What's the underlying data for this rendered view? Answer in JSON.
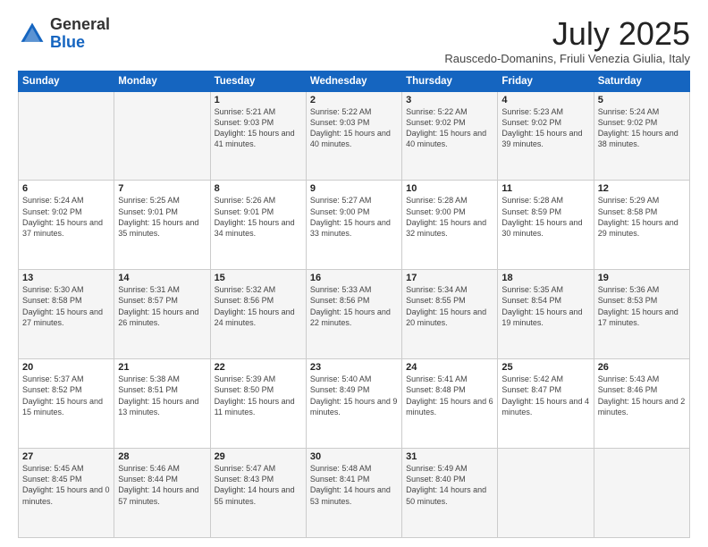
{
  "header": {
    "logo_general": "General",
    "logo_blue": "Blue",
    "title": "July 2025",
    "location": "Rauscedo-Domanins, Friuli Venezia Giulia, Italy"
  },
  "weekdays": [
    "Sunday",
    "Monday",
    "Tuesday",
    "Wednesday",
    "Thursday",
    "Friday",
    "Saturday"
  ],
  "weeks": [
    [
      {
        "day": "",
        "info": ""
      },
      {
        "day": "",
        "info": ""
      },
      {
        "day": "1",
        "info": "Sunrise: 5:21 AM\nSunset: 9:03 PM\nDaylight: 15 hours\nand 41 minutes."
      },
      {
        "day": "2",
        "info": "Sunrise: 5:22 AM\nSunset: 9:03 PM\nDaylight: 15 hours\nand 40 minutes."
      },
      {
        "day": "3",
        "info": "Sunrise: 5:22 AM\nSunset: 9:02 PM\nDaylight: 15 hours\nand 40 minutes."
      },
      {
        "day": "4",
        "info": "Sunrise: 5:23 AM\nSunset: 9:02 PM\nDaylight: 15 hours\nand 39 minutes."
      },
      {
        "day": "5",
        "info": "Sunrise: 5:24 AM\nSunset: 9:02 PM\nDaylight: 15 hours\nand 38 minutes."
      }
    ],
    [
      {
        "day": "6",
        "info": "Sunrise: 5:24 AM\nSunset: 9:02 PM\nDaylight: 15 hours\nand 37 minutes."
      },
      {
        "day": "7",
        "info": "Sunrise: 5:25 AM\nSunset: 9:01 PM\nDaylight: 15 hours\nand 35 minutes."
      },
      {
        "day": "8",
        "info": "Sunrise: 5:26 AM\nSunset: 9:01 PM\nDaylight: 15 hours\nand 34 minutes."
      },
      {
        "day": "9",
        "info": "Sunrise: 5:27 AM\nSunset: 9:00 PM\nDaylight: 15 hours\nand 33 minutes."
      },
      {
        "day": "10",
        "info": "Sunrise: 5:28 AM\nSunset: 9:00 PM\nDaylight: 15 hours\nand 32 minutes."
      },
      {
        "day": "11",
        "info": "Sunrise: 5:28 AM\nSunset: 8:59 PM\nDaylight: 15 hours\nand 30 minutes."
      },
      {
        "day": "12",
        "info": "Sunrise: 5:29 AM\nSunset: 8:58 PM\nDaylight: 15 hours\nand 29 minutes."
      }
    ],
    [
      {
        "day": "13",
        "info": "Sunrise: 5:30 AM\nSunset: 8:58 PM\nDaylight: 15 hours\nand 27 minutes."
      },
      {
        "day": "14",
        "info": "Sunrise: 5:31 AM\nSunset: 8:57 PM\nDaylight: 15 hours\nand 26 minutes."
      },
      {
        "day": "15",
        "info": "Sunrise: 5:32 AM\nSunset: 8:56 PM\nDaylight: 15 hours\nand 24 minutes."
      },
      {
        "day": "16",
        "info": "Sunrise: 5:33 AM\nSunset: 8:56 PM\nDaylight: 15 hours\nand 22 minutes."
      },
      {
        "day": "17",
        "info": "Sunrise: 5:34 AM\nSunset: 8:55 PM\nDaylight: 15 hours\nand 20 minutes."
      },
      {
        "day": "18",
        "info": "Sunrise: 5:35 AM\nSunset: 8:54 PM\nDaylight: 15 hours\nand 19 minutes."
      },
      {
        "day": "19",
        "info": "Sunrise: 5:36 AM\nSunset: 8:53 PM\nDaylight: 15 hours\nand 17 minutes."
      }
    ],
    [
      {
        "day": "20",
        "info": "Sunrise: 5:37 AM\nSunset: 8:52 PM\nDaylight: 15 hours\nand 15 minutes."
      },
      {
        "day": "21",
        "info": "Sunrise: 5:38 AM\nSunset: 8:51 PM\nDaylight: 15 hours\nand 13 minutes."
      },
      {
        "day": "22",
        "info": "Sunrise: 5:39 AM\nSunset: 8:50 PM\nDaylight: 15 hours\nand 11 minutes."
      },
      {
        "day": "23",
        "info": "Sunrise: 5:40 AM\nSunset: 8:49 PM\nDaylight: 15 hours\nand 9 minutes."
      },
      {
        "day": "24",
        "info": "Sunrise: 5:41 AM\nSunset: 8:48 PM\nDaylight: 15 hours\nand 6 minutes."
      },
      {
        "day": "25",
        "info": "Sunrise: 5:42 AM\nSunset: 8:47 PM\nDaylight: 15 hours\nand 4 minutes."
      },
      {
        "day": "26",
        "info": "Sunrise: 5:43 AM\nSunset: 8:46 PM\nDaylight: 15 hours\nand 2 minutes."
      }
    ],
    [
      {
        "day": "27",
        "info": "Sunrise: 5:45 AM\nSunset: 8:45 PM\nDaylight: 15 hours\nand 0 minutes."
      },
      {
        "day": "28",
        "info": "Sunrise: 5:46 AM\nSunset: 8:44 PM\nDaylight: 14 hours\nand 57 minutes."
      },
      {
        "day": "29",
        "info": "Sunrise: 5:47 AM\nSunset: 8:43 PM\nDaylight: 14 hours\nand 55 minutes."
      },
      {
        "day": "30",
        "info": "Sunrise: 5:48 AM\nSunset: 8:41 PM\nDaylight: 14 hours\nand 53 minutes."
      },
      {
        "day": "31",
        "info": "Sunrise: 5:49 AM\nSunset: 8:40 PM\nDaylight: 14 hours\nand 50 minutes."
      },
      {
        "day": "",
        "info": ""
      },
      {
        "day": "",
        "info": ""
      }
    ]
  ]
}
